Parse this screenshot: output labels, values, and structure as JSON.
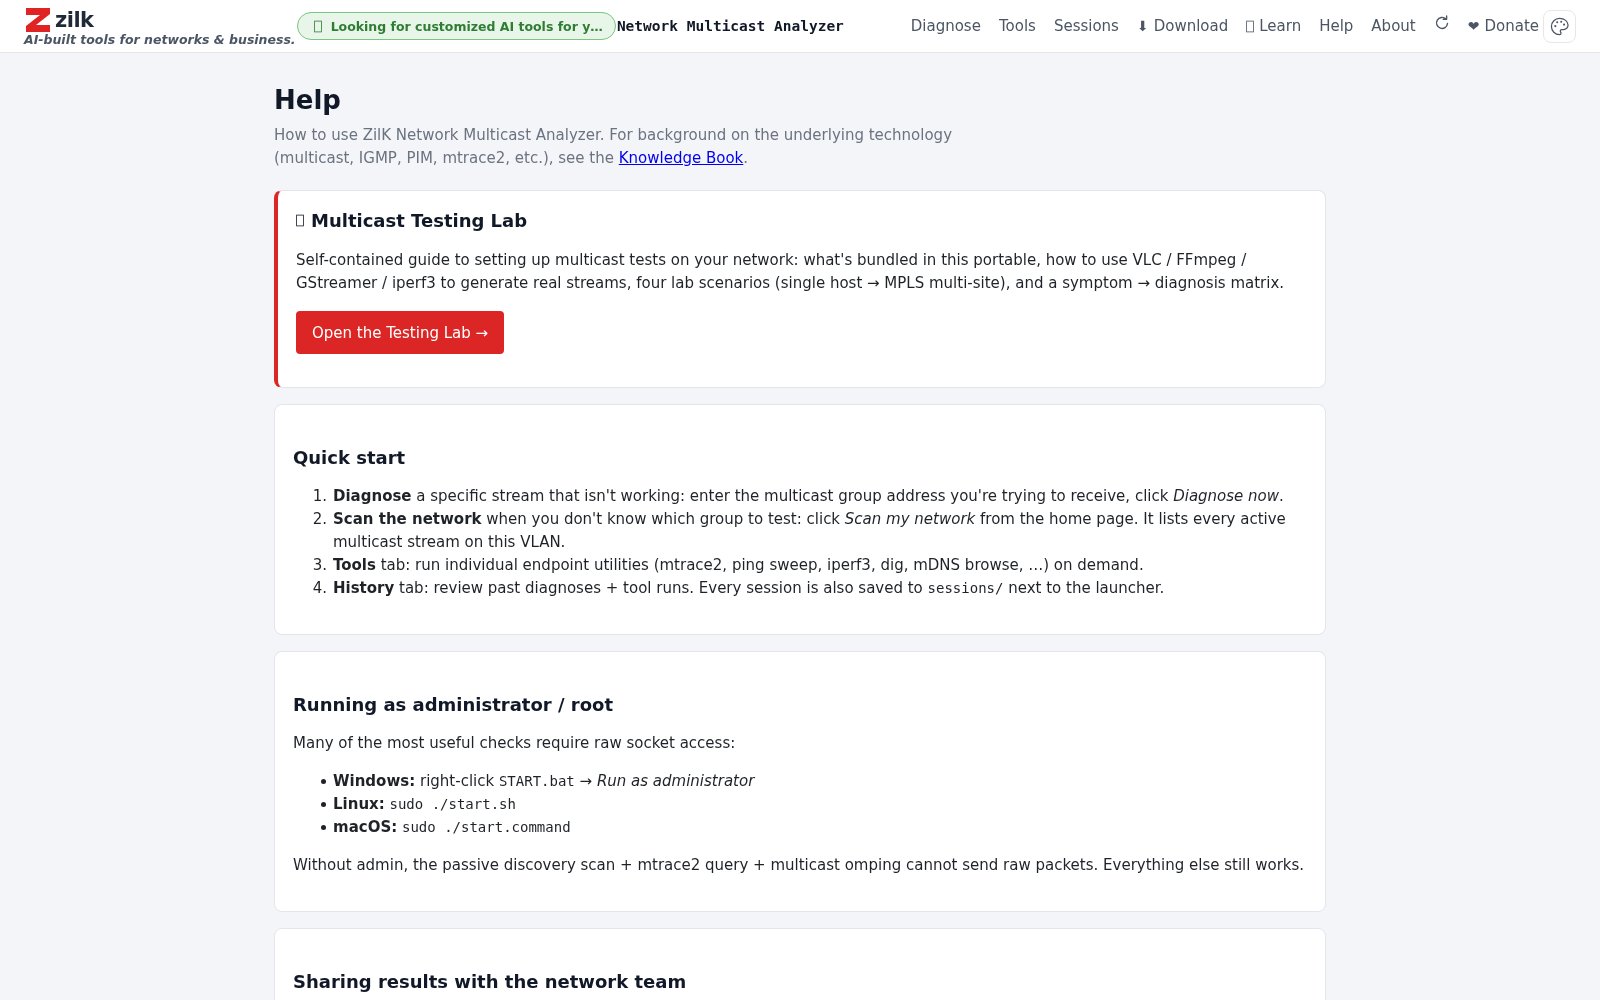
{
  "header": {
    "logo": {
      "wordmark": "zilk",
      "tagline": "AI-built tools for networks & business."
    },
    "promo": {
      "text": "Looking for customized AI tools for y…"
    },
    "app_title": "Network Multicast Analyzer",
    "nav": [
      {
        "kind": "link",
        "label": "Diagnose"
      },
      {
        "kind": "link",
        "label": "Tools"
      },
      {
        "kind": "link",
        "label": "Sessions"
      },
      {
        "kind": "glyph",
        "glyph": "⬇",
        "label": "Download"
      },
      {
        "kind": "boxed",
        "label": "Learn"
      },
      {
        "kind": "link",
        "label": "Help"
      },
      {
        "kind": "link",
        "label": "About"
      },
      {
        "kind": "refresh"
      },
      {
        "kind": "glyph",
        "glyph": "❤",
        "label": "Donate"
      },
      {
        "kind": "theme"
      }
    ]
  },
  "page": {
    "title": "Help",
    "intro": [
      {
        "kind": "text",
        "text": "How to use ZilK Network Multicast Analyzer. For background on the underlying technology (multicast, IGMP, PIM, mtrace2, etc.), see the "
      },
      {
        "kind": "link",
        "text": "Knowledge Book"
      },
      {
        "kind": "text",
        "text": "."
      }
    ]
  },
  "lab_card": {
    "title": "Multicast Testing Lab",
    "text": "Self-contained guide to setting up multicast tests on your network: what's bundled in this portable, how to use VLC / FFmpeg / GStreamer / iperf3 to generate real streams, four lab scenarios (single host → MPLS multi-site), and a symptom → diagnosis matrix.",
    "button": "Open the Testing Lab →"
  },
  "sections": [
    {
      "title": "Quick start",
      "blocks": [
        {
          "kind": "numbered",
          "items": [
            {
              "number": "1.",
              "parts": [
                {
                  "kind": "text",
                  "text": "**Diagnose** a specific stream that isn't working: enter the multicast group address you're trying to receive, click *Diagnose now*."
                }
              ]
            },
            {
              "number": "2.",
              "parts": [
                {
                  "kind": "text",
                  "text": "**Scan the network** when you don't know which group to test: click *Scan my network* from the home page. It lists every active multicast stream on this VLAN."
                }
              ]
            },
            {
              "number": "3.",
              "parts": [
                {
                  "kind": "text",
                  "text": "**Tools** tab: run individual endpoint utilities (mtrace2, ping sweep, iperf3, dig, mDNS browse, …) on demand."
                }
              ]
            },
            {
              "number": "4.",
              "parts": [
                {
                  "kind": "text",
                  "text": "**History** tab: review past diagnoses + tool runs. Every session is also saved to "
                },
                {
                  "kind": "code",
                  "text": "sessions/"
                },
                {
                  "kind": "text",
                  "text": " next to the launcher."
                }
              ]
            }
          ]
        }
      ]
    },
    {
      "title": "Running as administrator / root",
      "blocks": [
        {
          "kind": "paragraph",
          "parts": [
            {
              "kind": "text",
              "text": "Many of the most useful checks require raw socket access:"
            }
          ]
        },
        {
          "kind": "bulleted",
          "items": [
            {
              "parts": [
                {
                  "kind": "text",
                  "text": "**Windows:** right-click "
                },
                {
                  "kind": "code",
                  "text": "START.bat"
                },
                {
                  "kind": "text",
                  "text": " → *Run as administrator*"
                }
              ]
            },
            {
              "parts": [
                {
                  "kind": "text",
                  "text": "**Linux:** "
                },
                {
                  "kind": "code",
                  "text": "sudo ./start.sh"
                }
              ]
            },
            {
              "parts": [
                {
                  "kind": "text",
                  "text": "**macOS:** "
                },
                {
                  "kind": "code",
                  "text": "sudo ./start.command"
                }
              ]
            }
          ]
        },
        {
          "kind": "paragraph",
          "parts": [
            {
              "kind": "text",
              "text": "Without admin, the passive discovery scan + mtrace2 query + multicast omping cannot send raw packets. Everything else still works."
            }
          ]
        }
      ]
    },
    {
      "title": "Sharing results with the network team"
    }
  ]
}
